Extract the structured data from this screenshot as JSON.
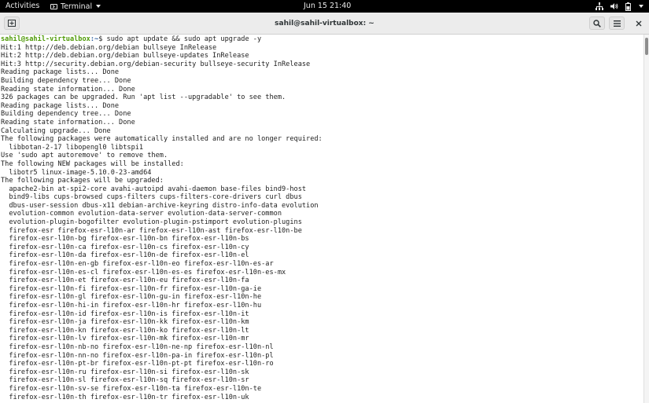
{
  "topbar": {
    "activities": "Activities",
    "app_name": "Terminal",
    "clock": "Jun 15  21:40",
    "tray_icons": [
      "network-icon",
      "volume-icon",
      "battery-icon",
      "system-menu-caret-icon"
    ]
  },
  "window": {
    "title": "sahil@sahil-virtualbox: ~",
    "new_tab_icon": "new-tab-icon",
    "search_icon": "search-icon",
    "menu_icon": "hamburger-menu-icon",
    "close_icon": "close-icon"
  },
  "prompt": {
    "user_host": "sahil@sahil-virtualbox",
    "path_sep": ":~$ ",
    "command": "sudo apt update && sudo apt upgrade -y"
  },
  "output": [
    "Hit:1 http://deb.debian.org/debian bullseye InRelease",
    "Hit:2 http://deb.debian.org/debian bullseye-updates InRelease",
    "Hit:3 http://security.debian.org/debian-security bullseye-security InRelease",
    "Reading package lists... Done",
    "Building dependency tree... Done",
    "Reading state information... Done",
    "326 packages can be upgraded. Run 'apt list --upgradable' to see them.",
    "Reading package lists... Done",
    "Building dependency tree... Done",
    "Reading state information... Done",
    "Calculating upgrade... Done",
    "The following packages were automatically installed and are no longer required:",
    "  libbotan-2-17 libopengl0 libtspi1",
    "Use 'sudo apt autoremove' to remove them.",
    "The following NEW packages will be installed:",
    "  libotr5 linux-image-5.10.0-23-amd64",
    "The following packages will be upgraded:",
    "  apache2-bin at-spi2-core avahi-autoipd avahi-daemon base-files bind9-host",
    "  bind9-libs cups-browsed cups-filters cups-filters-core-drivers curl dbus",
    "  dbus-user-session dbus-x11 debian-archive-keyring distro-info-data evolution",
    "  evolution-common evolution-data-server evolution-data-server-common",
    "  evolution-plugin-bogofilter evolution-plugin-pstimport evolution-plugins",
    "  firefox-esr firefox-esr-l10n-ar firefox-esr-l10n-ast firefox-esr-l10n-be",
    "  firefox-esr-l10n-bg firefox-esr-l10n-bn firefox-esr-l10n-bs",
    "  firefox-esr-l10n-ca firefox-esr-l10n-cs firefox-esr-l10n-cy",
    "  firefox-esr-l10n-da firefox-esr-l10n-de firefox-esr-l10n-el",
    "  firefox-esr-l10n-en-gb firefox-esr-l10n-eo firefox-esr-l10n-es-ar",
    "  firefox-esr-l10n-es-cl firefox-esr-l10n-es-es firefox-esr-l10n-es-mx",
    "  firefox-esr-l10n-et firefox-esr-l10n-eu firefox-esr-l10n-fa",
    "  firefox-esr-l10n-fi firefox-esr-l10n-fr firefox-esr-l10n-ga-ie",
    "  firefox-esr-l10n-gl firefox-esr-l10n-gu-in firefox-esr-l10n-he",
    "  firefox-esr-l10n-hi-in firefox-esr-l10n-hr firefox-esr-l10n-hu",
    "  firefox-esr-l10n-id firefox-esr-l10n-is firefox-esr-l10n-it",
    "  firefox-esr-l10n-ja firefox-esr-l10n-kk firefox-esr-l10n-km",
    "  firefox-esr-l10n-kn firefox-esr-l10n-ko firefox-esr-l10n-lt",
    "  firefox-esr-l10n-lv firefox-esr-l10n-mk firefox-esr-l10n-mr",
    "  firefox-esr-l10n-nb-no firefox-esr-l10n-ne-np firefox-esr-l10n-nl",
    "  firefox-esr-l10n-nn-no firefox-esr-l10n-pa-in firefox-esr-l10n-pl",
    "  firefox-esr-l10n-pt-br firefox-esr-l10n-pt-pt firefox-esr-l10n-ro",
    "  firefox-esr-l10n-ru firefox-esr-l10n-si firefox-esr-l10n-sk",
    "  firefox-esr-l10n-sl firefox-esr-l10n-sq firefox-esr-l10n-sr",
    "  firefox-esr-l10n-sv-se firefox-esr-l10n-ta firefox-esr-l10n-te",
    "  firefox-esr-l10n-th firefox-esr-l10n-tr firefox-esr-l10n-uk"
  ],
  "colors": {
    "prompt_user": "#4e9a06",
    "prompt_path": "#3465a4",
    "text": "#1e1e1e",
    "background": "#ffffff",
    "topbar": "#000000"
  }
}
